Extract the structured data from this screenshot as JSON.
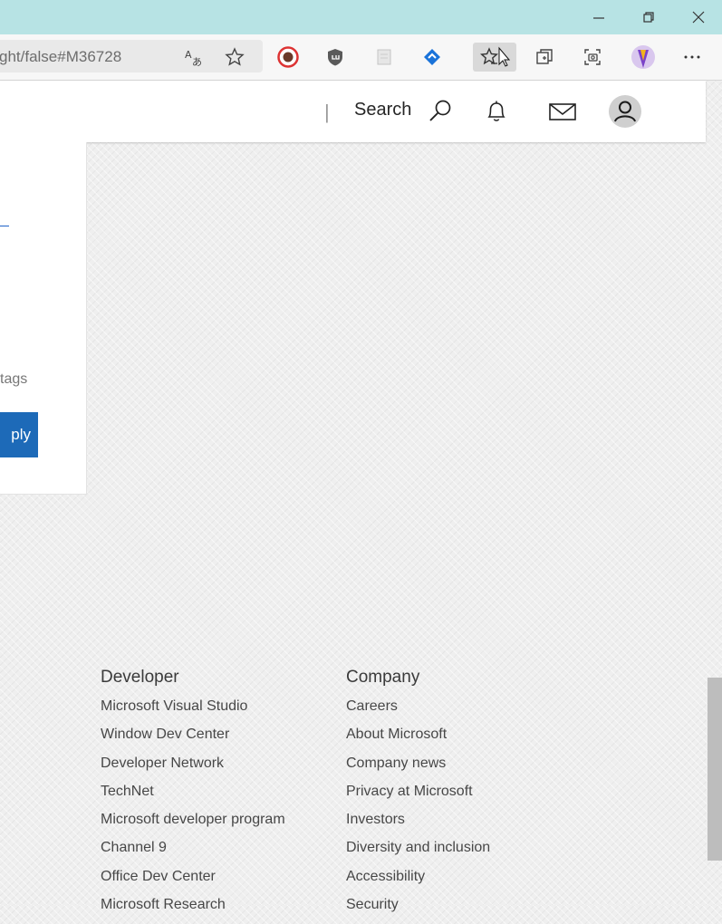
{
  "browser": {
    "url_fragment": "ght/false#M36728",
    "window_controls": [
      "minimize",
      "restore",
      "close"
    ],
    "toolbar_icons": [
      "read-aloud-icon",
      "favorite-star-icon",
      "extension-avatar-icon",
      "ublock-shield-icon",
      "extension-page-icon",
      "extension-diamond-icon",
      "favorites-bar-icon",
      "collections-icon",
      "screenshot-icon",
      "profile-icon",
      "more-menu-icon"
    ],
    "accent": "#b7e3e4"
  },
  "site_header": {
    "divider": "|",
    "search_label": "Search",
    "icons": [
      "search-icon",
      "bell-icon",
      "mail-icon",
      "user-avatar-icon"
    ]
  },
  "card": {
    "tags_label": "tags",
    "reply_label": "ply",
    "reply_color": "#1d6ab8"
  },
  "footer": {
    "developer": {
      "heading": "Developer",
      "links": [
        "Microsoft Visual Studio",
        "Window Dev Center",
        "Developer Network",
        "TechNet",
        "Microsoft developer program",
        "Channel 9",
        "Office Dev Center",
        "Microsoft Research"
      ]
    },
    "company": {
      "heading": "Company",
      "links": [
        "Careers",
        "About Microsoft",
        "Company news",
        "Privacy at Microsoft",
        "Investors",
        "Diversity and inclusion",
        "Accessibility",
        "Security"
      ]
    }
  }
}
